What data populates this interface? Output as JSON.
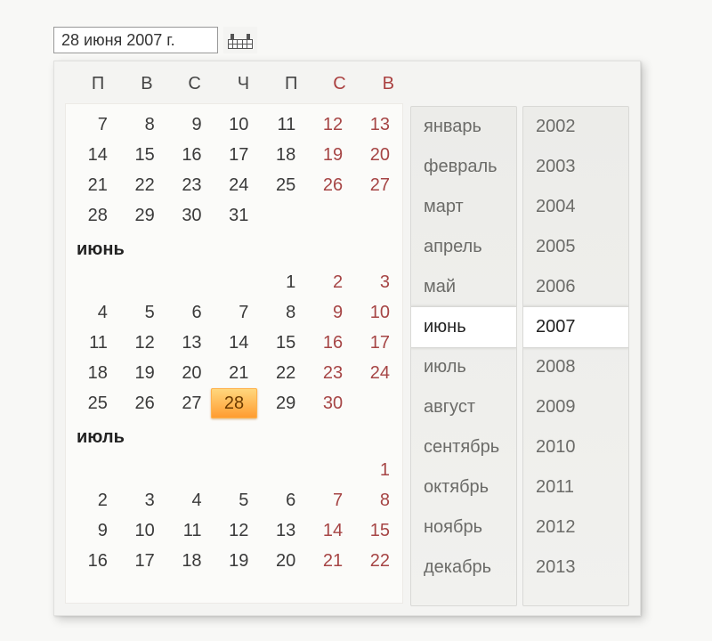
{
  "input": {
    "value": "28 июня 2007 г."
  },
  "dow": [
    "П",
    "В",
    "С",
    "Ч",
    "П",
    "С",
    "В"
  ],
  "months_visible": [
    {
      "name": null,
      "weeks": [
        [
          7,
          8,
          9,
          10,
          11,
          12,
          13
        ],
        [
          14,
          15,
          16,
          17,
          18,
          19,
          20
        ],
        [
          21,
          22,
          23,
          24,
          25,
          26,
          27
        ],
        [
          28,
          29,
          30,
          31,
          null,
          null,
          null
        ]
      ]
    },
    {
      "name": "июнь",
      "weeks": [
        [
          null,
          null,
          null,
          null,
          1,
          2,
          3
        ],
        [
          4,
          5,
          6,
          7,
          8,
          9,
          10
        ],
        [
          11,
          12,
          13,
          14,
          15,
          16,
          17
        ],
        [
          18,
          19,
          20,
          21,
          22,
          23,
          24
        ],
        [
          25,
          26,
          27,
          28,
          29,
          30,
          null
        ]
      ],
      "selected_day": 28
    },
    {
      "name": "июль",
      "weeks": [
        [
          null,
          null,
          null,
          null,
          null,
          null,
          1
        ],
        [
          2,
          3,
          4,
          5,
          6,
          7,
          8
        ],
        [
          9,
          10,
          11,
          12,
          13,
          14,
          15
        ],
        [
          16,
          17,
          18,
          19,
          20,
          21,
          22
        ]
      ]
    }
  ],
  "month_list": {
    "items": [
      "январь",
      "февраль",
      "март",
      "апрель",
      "май",
      "июнь",
      "июль",
      "август",
      "сентябрь",
      "октябрь",
      "ноябрь",
      "декабрь"
    ],
    "selected": "июнь"
  },
  "year_list": {
    "items": [
      "2002",
      "2003",
      "2004",
      "2005",
      "2006",
      "2007",
      "2008",
      "2009",
      "2010",
      "2011",
      "2012",
      "2013"
    ],
    "selected": "2007"
  }
}
